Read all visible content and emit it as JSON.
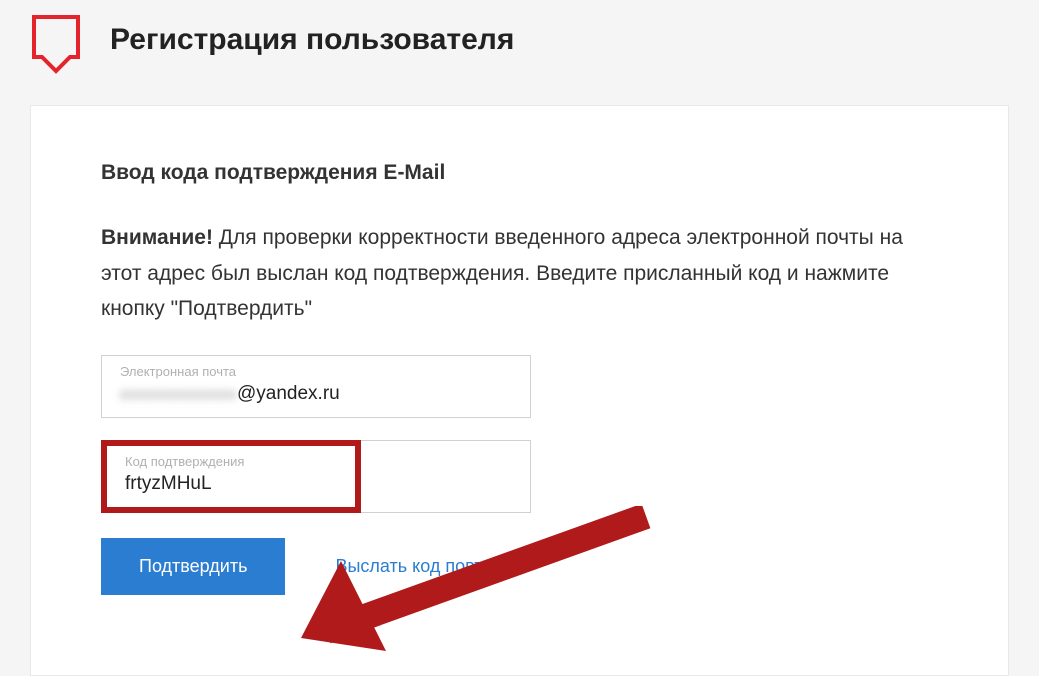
{
  "header": {
    "title": "Регистрация пользователя"
  },
  "section": {
    "title": "Ввод кода подтверждения E-Mail",
    "attention_label": "Внимание!",
    "info_text": " Для проверки корректности введенного адреса электронной почты на этот адрес был выслан код подтверждения. Введите присланный код и нажмите кнопку \"Подтвердить\""
  },
  "email_field": {
    "label": "Электронная почта",
    "value_visible": "@yandex.ru"
  },
  "code_field": {
    "label": "Код подтверждения",
    "value": "frtyzMHuL"
  },
  "actions": {
    "confirm_label": "Подтвердить",
    "resend_label": "Выслать код повторно"
  }
}
